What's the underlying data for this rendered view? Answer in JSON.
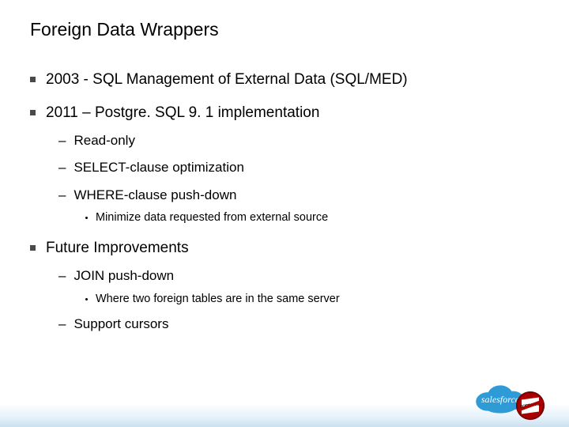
{
  "title": "Foreign Data Wrappers",
  "bullets": [
    {
      "text": "2003 - SQL Management of External Data (SQL/MED)",
      "children": []
    },
    {
      "text": "2011 – Postgre. SQL 9. 1 implementation",
      "children": [
        {
          "text": "Read-only",
          "children": []
        },
        {
          "text": "SELECT-clause optimization",
          "children": []
        },
        {
          "text": "WHERE-clause push-down",
          "children": [
            {
              "text": "Minimize data requested from external source"
            }
          ]
        }
      ]
    },
    {
      "text": "Future Improvements",
      "children": [
        {
          "text": "JOIN push-down",
          "children": [
            {
              "text": "Where two foreign tables are in the same server"
            }
          ]
        },
        {
          "text": "Support cursors",
          "children": []
        }
      ]
    }
  ],
  "logo": {
    "brand_prefix": "sales",
    "brand_suffix": "force",
    "stamp_text": "SOFTWARE"
  }
}
